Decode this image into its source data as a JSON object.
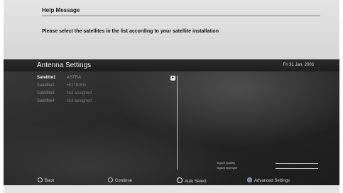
{
  "help": {
    "title": "Help Message",
    "message": "Please select the satellites in the list according to your satellite installation"
  },
  "panel": {
    "title": "Antenna Settings",
    "date": "Fri 31 Jan. 2003"
  },
  "rows": [
    {
      "label": "Satellite1",
      "value": "ASTRA",
      "active": true
    },
    {
      "label": "Satellite2",
      "value": "HOTBIRD",
      "active": false
    },
    {
      "label": "Satellite3",
      "value": "Not assigned",
      "active": false
    },
    {
      "label": "Satellite4",
      "value": "Not assigned",
      "active": false
    }
  ],
  "signal": {
    "quality_label": "signal quality",
    "strength_label": "signal strength"
  },
  "footer": {
    "back": "Back",
    "continue": "Continue",
    "auto_select": "Auto Select",
    "advanced": "Advanced Settings"
  },
  "colors": {
    "panel_bg": "#262626",
    "help_bg": "#dcdcdc",
    "active_text": "#f0f0f0",
    "inactive_text": "#8a8a8a"
  }
}
